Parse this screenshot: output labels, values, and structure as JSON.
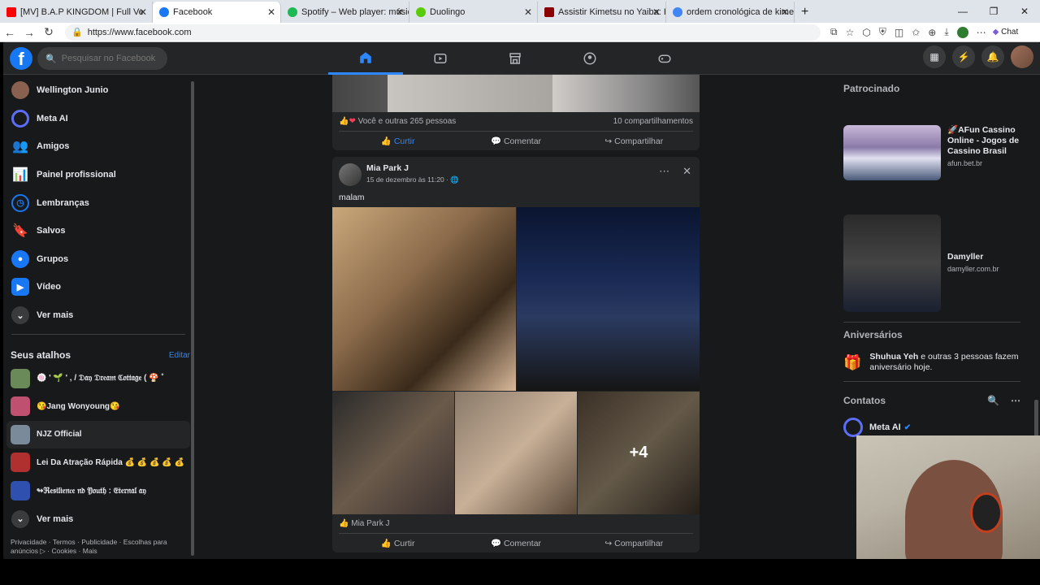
{
  "browser": {
    "tabs": [
      {
        "label": "[MV] B.A.P KINGDOM | Full Ve",
        "color": "#ff0000"
      },
      {
        "label": "Facebook",
        "color": "#1877f2",
        "active": true
      },
      {
        "label": "Spotify – Web player: música para",
        "color": "#1db954"
      },
      {
        "label": "Duolingo",
        "color": "#58cc02"
      },
      {
        "label": "Assistir Kimetsu no Yaiba: Hashira",
        "color": "#8b0000"
      },
      {
        "label": "ordem cronológica de kimetsu no",
        "color": "#4285f4"
      }
    ],
    "url": "https://www.facebook.com",
    "chat_label": "Chat"
  },
  "topbar": {
    "logo": "f",
    "search_placeholder": "Pesquisar no Facebook"
  },
  "leftnav": {
    "items": [
      {
        "label": "Wellington Junio",
        "icon": "profile-avatar",
        "color": "#8a6050"
      },
      {
        "label": "Meta AI",
        "icon": "meta-ai-icon",
        "color": "#3b5bdb"
      },
      {
        "label": "Amigos",
        "icon": "friends-icon",
        "color": "#1877f2"
      },
      {
        "label": "Painel profissional",
        "icon": "dashboard-icon",
        "color": "#1877f2"
      },
      {
        "label": "Lembranças",
        "icon": "memories-icon",
        "color": "#1877f2"
      },
      {
        "label": "Salvos",
        "icon": "saved-icon",
        "color": "#a33cc7"
      },
      {
        "label": "Grupos",
        "icon": "groups-icon",
        "color": "#1877f2"
      },
      {
        "label": "Vídeo",
        "icon": "video-icon",
        "color": "#1877f2"
      },
      {
        "label": "Ver mais",
        "icon": "chevron-down-icon",
        "color": "#3a3b3c"
      }
    ],
    "shortcuts_title": "Seus atalhos",
    "edit_label": "Editar",
    "shortcuts": [
      {
        "label": "🍥 ' 🌱 ' , / 𝔇𝔞𝔶 𝔇𝔯𝔢𝔞𝔪 ℭ𝔬𝔱𝔱𝔞𝔤𝔢 ( 🍄 ˚",
        "color": "#6a8a5a"
      },
      {
        "label": "😘Jang Wonyoung😘",
        "color": "#c05070"
      },
      {
        "label": "NJZ Official",
        "color": "#7a8a9a"
      },
      {
        "label": "Lei Da Atração Rápida 💰 💰 💰 💰 💰",
        "color": "#b03030"
      },
      {
        "label": "↬ℜ𝔢𝔰𝔦𝔩𝔦𝔢𝔫𝔠𝔢 𝔫𝔡 𝔜𝔬𝔲𝔱𝔥 : 𝔈𝔱𝔢𝔯𝔫𝔞𝔩 𝔞𝔶",
        "color": "#3050b0"
      }
    ],
    "more_label": "Ver mais",
    "footer": "Privacidade · Termos · Publicidade · Escolhas para anúncios ▷ · Cookies · Mais"
  },
  "feed": {
    "prev_post": {
      "reactions": "Você e outras 265 pessoas",
      "shares": "10 compartilhamentos",
      "like": "Curtir",
      "comment": "Comentar",
      "share": "Compartilhar"
    },
    "post": {
      "author": "Mia Park J",
      "date": "15 de dezembro às 11:20 · 🌐",
      "text": "malam",
      "more_photos": "+4",
      "reaction_name": "Mia Park J",
      "like": "Curtir",
      "comment": "Comentar",
      "share": "Compartilhar"
    }
  },
  "rightcol": {
    "sponsored_title": "Patrocinado",
    "ads": [
      {
        "title": "🚀AFun Cassino Online - Jogos de Cassino Brasil",
        "url": "afun.bet.br"
      },
      {
        "title": "Damyller",
        "url": "damyller.com.br"
      }
    ],
    "birthdays_title": "Aniversários",
    "birthday_name": "Shuhua Yeh",
    "birthday_text": " e outras 3 pessoas fazem aniversário hoje.",
    "contacts_title": "Contatos",
    "contacts": [
      {
        "name": "Meta AI"
      }
    ]
  }
}
